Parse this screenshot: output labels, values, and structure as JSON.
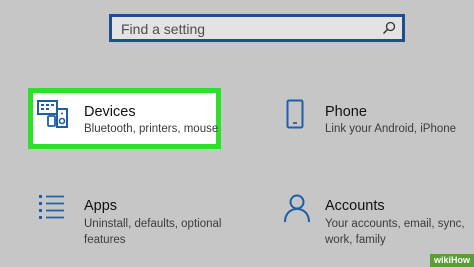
{
  "search": {
    "placeholder": "Find a setting"
  },
  "tiles": {
    "devices": {
      "title": "Devices",
      "desc": "Bluetooth, printers, mouse",
      "icon": "devices-icon"
    },
    "phone": {
      "title": "Phone",
      "desc": "Link your Android, iPhone",
      "icon": "phone-icon"
    },
    "apps": {
      "title": "Apps",
      "desc": "Uninstall, defaults, optional features",
      "icon": "apps-icon"
    },
    "accounts": {
      "title": "Accounts",
      "desc": "Your accounts, email, sync, work, family",
      "icon": "person-icon"
    }
  },
  "colors": {
    "accent": "#1f4e8c",
    "highlight": "#2ee02e",
    "background": "#c6c6c6"
  },
  "watermark": "wikiHow"
}
